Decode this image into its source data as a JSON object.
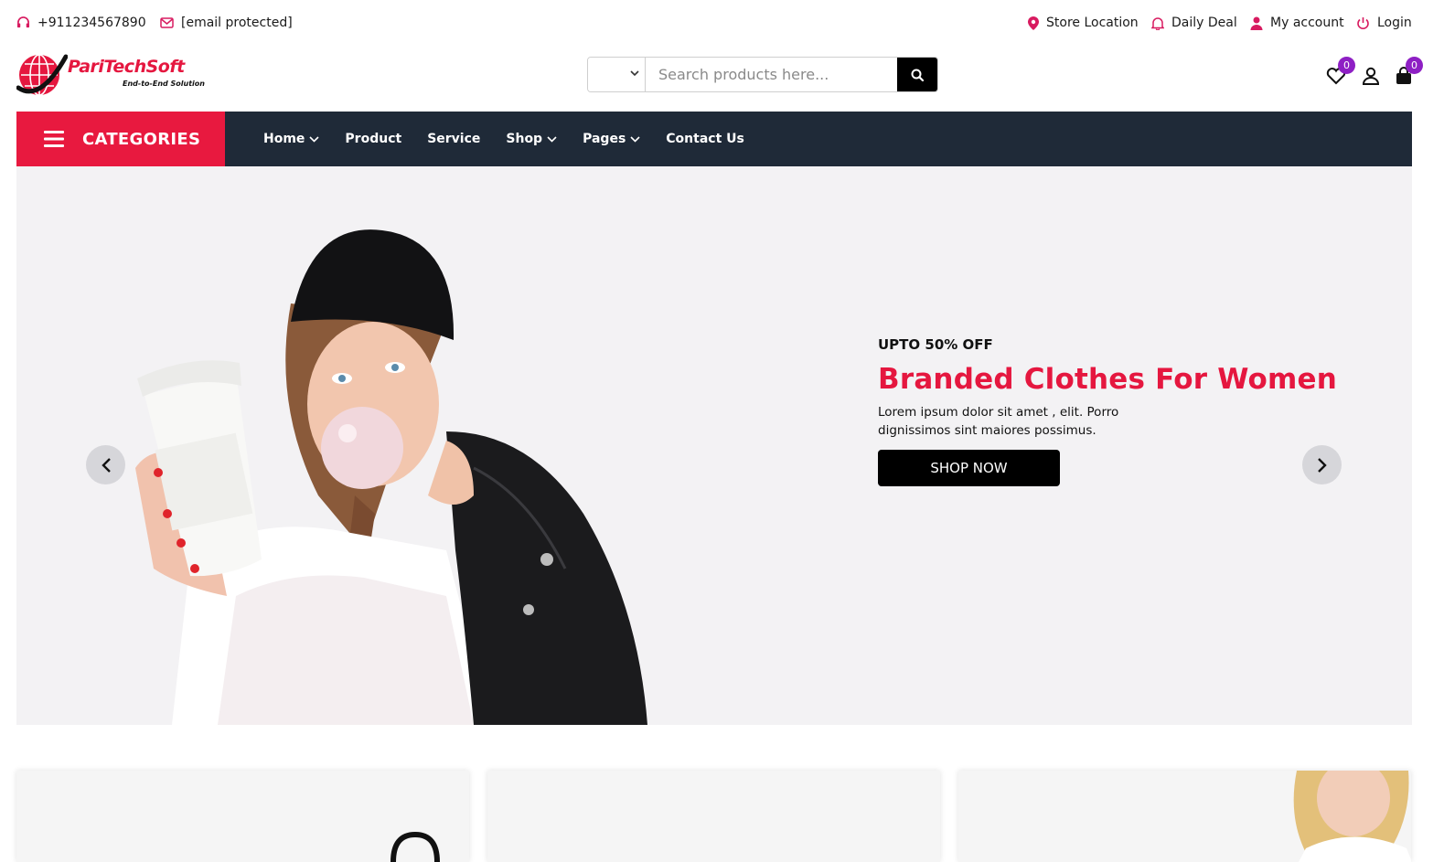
{
  "topbar": {
    "phone": "+911234567890",
    "email": "[email protected]",
    "store_location": "Store Location",
    "daily_deal": "Daily Deal",
    "my_account": "My account",
    "login": "Login"
  },
  "header": {
    "logo_name": "PariTechSoft",
    "logo_tagline": "End-to-End Solution",
    "search_placeholder": "Search products here...",
    "wishlist_count": "0",
    "cart_count": "0"
  },
  "nav": {
    "categories_label": "CATEGORIES",
    "links": [
      {
        "label": "Home",
        "has_dropdown": true
      },
      {
        "label": "Product",
        "has_dropdown": false
      },
      {
        "label": "Service",
        "has_dropdown": false
      },
      {
        "label": "Shop",
        "has_dropdown": true
      },
      {
        "label": "Pages",
        "has_dropdown": true
      },
      {
        "label": "Contact Us",
        "has_dropdown": false
      }
    ]
  },
  "hero": {
    "subtitle": "UPTO 50% OFF",
    "title": "Branded Clothes For Women",
    "description": "Lorem ipsum dolor sit amet , elit. Porro dignissimos sint maiores possimus.",
    "cta": "SHOP NOW"
  },
  "colors": {
    "brand_red": "#e8193f",
    "nav_dark": "#1f2a38",
    "badge_purple": "#8e1fc4",
    "icon_pink": "#d81b60"
  }
}
